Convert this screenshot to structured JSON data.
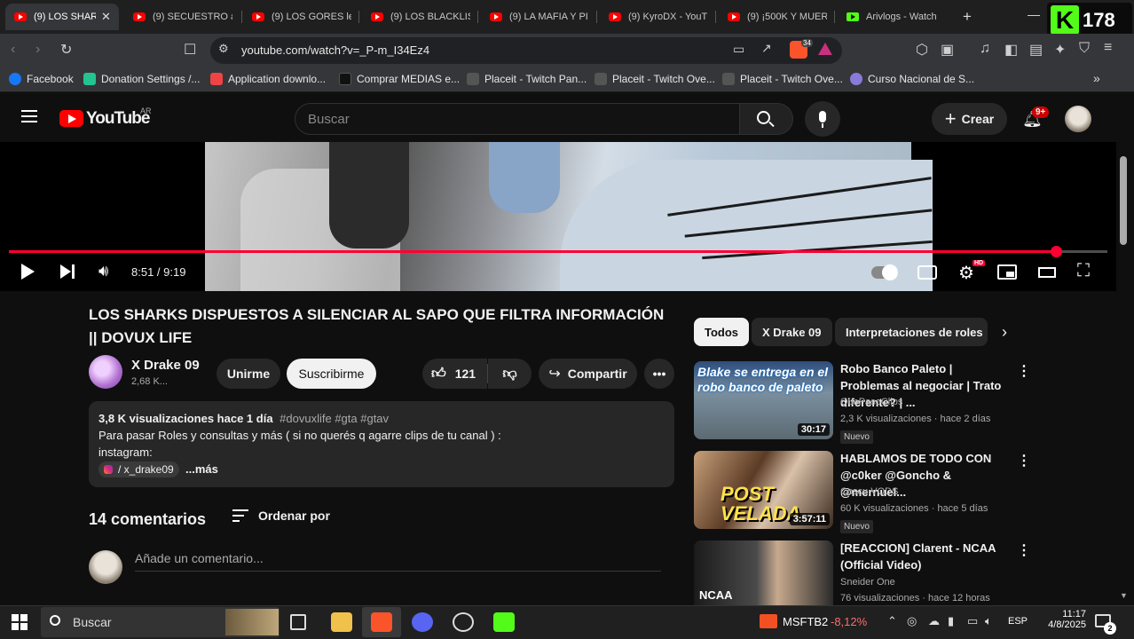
{
  "browser": {
    "tabs": [
      {
        "title": "(9) LOS SHARKS",
        "active": true
      },
      {
        "title": "(9) SECUESTRO a"
      },
      {
        "title": "(9) LOS GORES le"
      },
      {
        "title": "(9) LOS BLACKLIS"
      },
      {
        "title": "(9) LA MAFIA Y PI"
      },
      {
        "title": "(9) KyroDX - YouT"
      },
      {
        "title": "(9) ¡500K Y MUER"
      },
      {
        "title": "Arivlogs - Watch"
      }
    ],
    "new_tab": "+",
    "url": "youtube.com/watch?v=_P-m_I34Ez4",
    "brave_badge": "34",
    "bookmarks": [
      "Facebook",
      "Donation Settings /...",
      "Application downlo...",
      "Comprar MEDIAS e...",
      "Placeit - Twitch Pan...",
      "Placeit - Twitch Ove...",
      "Placeit - Twitch Ove...",
      "Curso Nacional de S..."
    ],
    "overlay_count": "178"
  },
  "youtube": {
    "logo": "YouTube",
    "region": "AR",
    "search_placeholder": "Buscar",
    "create_label": "Crear",
    "notif_badge": "9+"
  },
  "player": {
    "time": "8:51 / 9:19",
    "progress": 0.953,
    "hd": "HD"
  },
  "video": {
    "title_line1": "LOS SHARKS DISPUESTOS A SILENCIAR AL SAPO QUE FILTRA INFORMACIÓN",
    "title_line2": "|| DOVUX LIFE",
    "channel": "X Drake 09",
    "subs": "2,68 K...",
    "join": "Unirme",
    "subscribe": "Suscribirme",
    "likes": "121",
    "share": "Compartir",
    "desc_meta": "3,8 K visualizaciones  hace 1 día",
    "desc_tags": "#dovuxlife #gta #gtav",
    "desc_line1": "Para pasar Roles y consultas  y más ( si no querés q agarre clips de tu canal )  :",
    "desc_line2": "instagram:",
    "desc_ig": "/ x_drake09",
    "desc_more": "...más",
    "comments_count": "14 comentarios",
    "sort": "Ordenar por",
    "comment_placeholder": "Añade un comentario..."
  },
  "sidebar": {
    "chips": [
      "Todos",
      "X Drake 09",
      "Interpretaciones de roles"
    ],
    "videos": [
      {
        "title": "Robo Banco Paleto | Problemas al negociar | Trato diferente? | ...",
        "channel": "QuePasoClips",
        "meta": "2,3 K visualizaciones · hace 2 días",
        "badge": "Nuevo",
        "duration": "30:17",
        "thumb_text": "Blake se entrega en el robo banco de paleto"
      },
      {
        "title": "HABLAMOS DE TODO CON @c0ker @Goncho & @mernuel...",
        "channel": "Coscu VODS",
        "meta": "60 K visualizaciones · hace 5 días",
        "badge": "Nuevo",
        "duration": "3:57:11",
        "thumb_text": "POST VELADA"
      },
      {
        "title": "[REACCION] Clarent - NCAA (Official Video)",
        "channel": "Sneider One",
        "meta": "76 visualizaciones · hace 12 horas",
        "thumb_text": "NCAA"
      }
    ]
  },
  "taskbar": {
    "search": "Buscar",
    "stock_name": "MSFTB2",
    "stock_change": "-8,12%",
    "lang": "ESP",
    "time": "11:17",
    "date": "4/8/2025",
    "notif": "2"
  },
  "colors": {
    "accent": "#ff0033",
    "background": "#0f0f0f",
    "chip": "#272727",
    "kick": "#53fc18"
  }
}
